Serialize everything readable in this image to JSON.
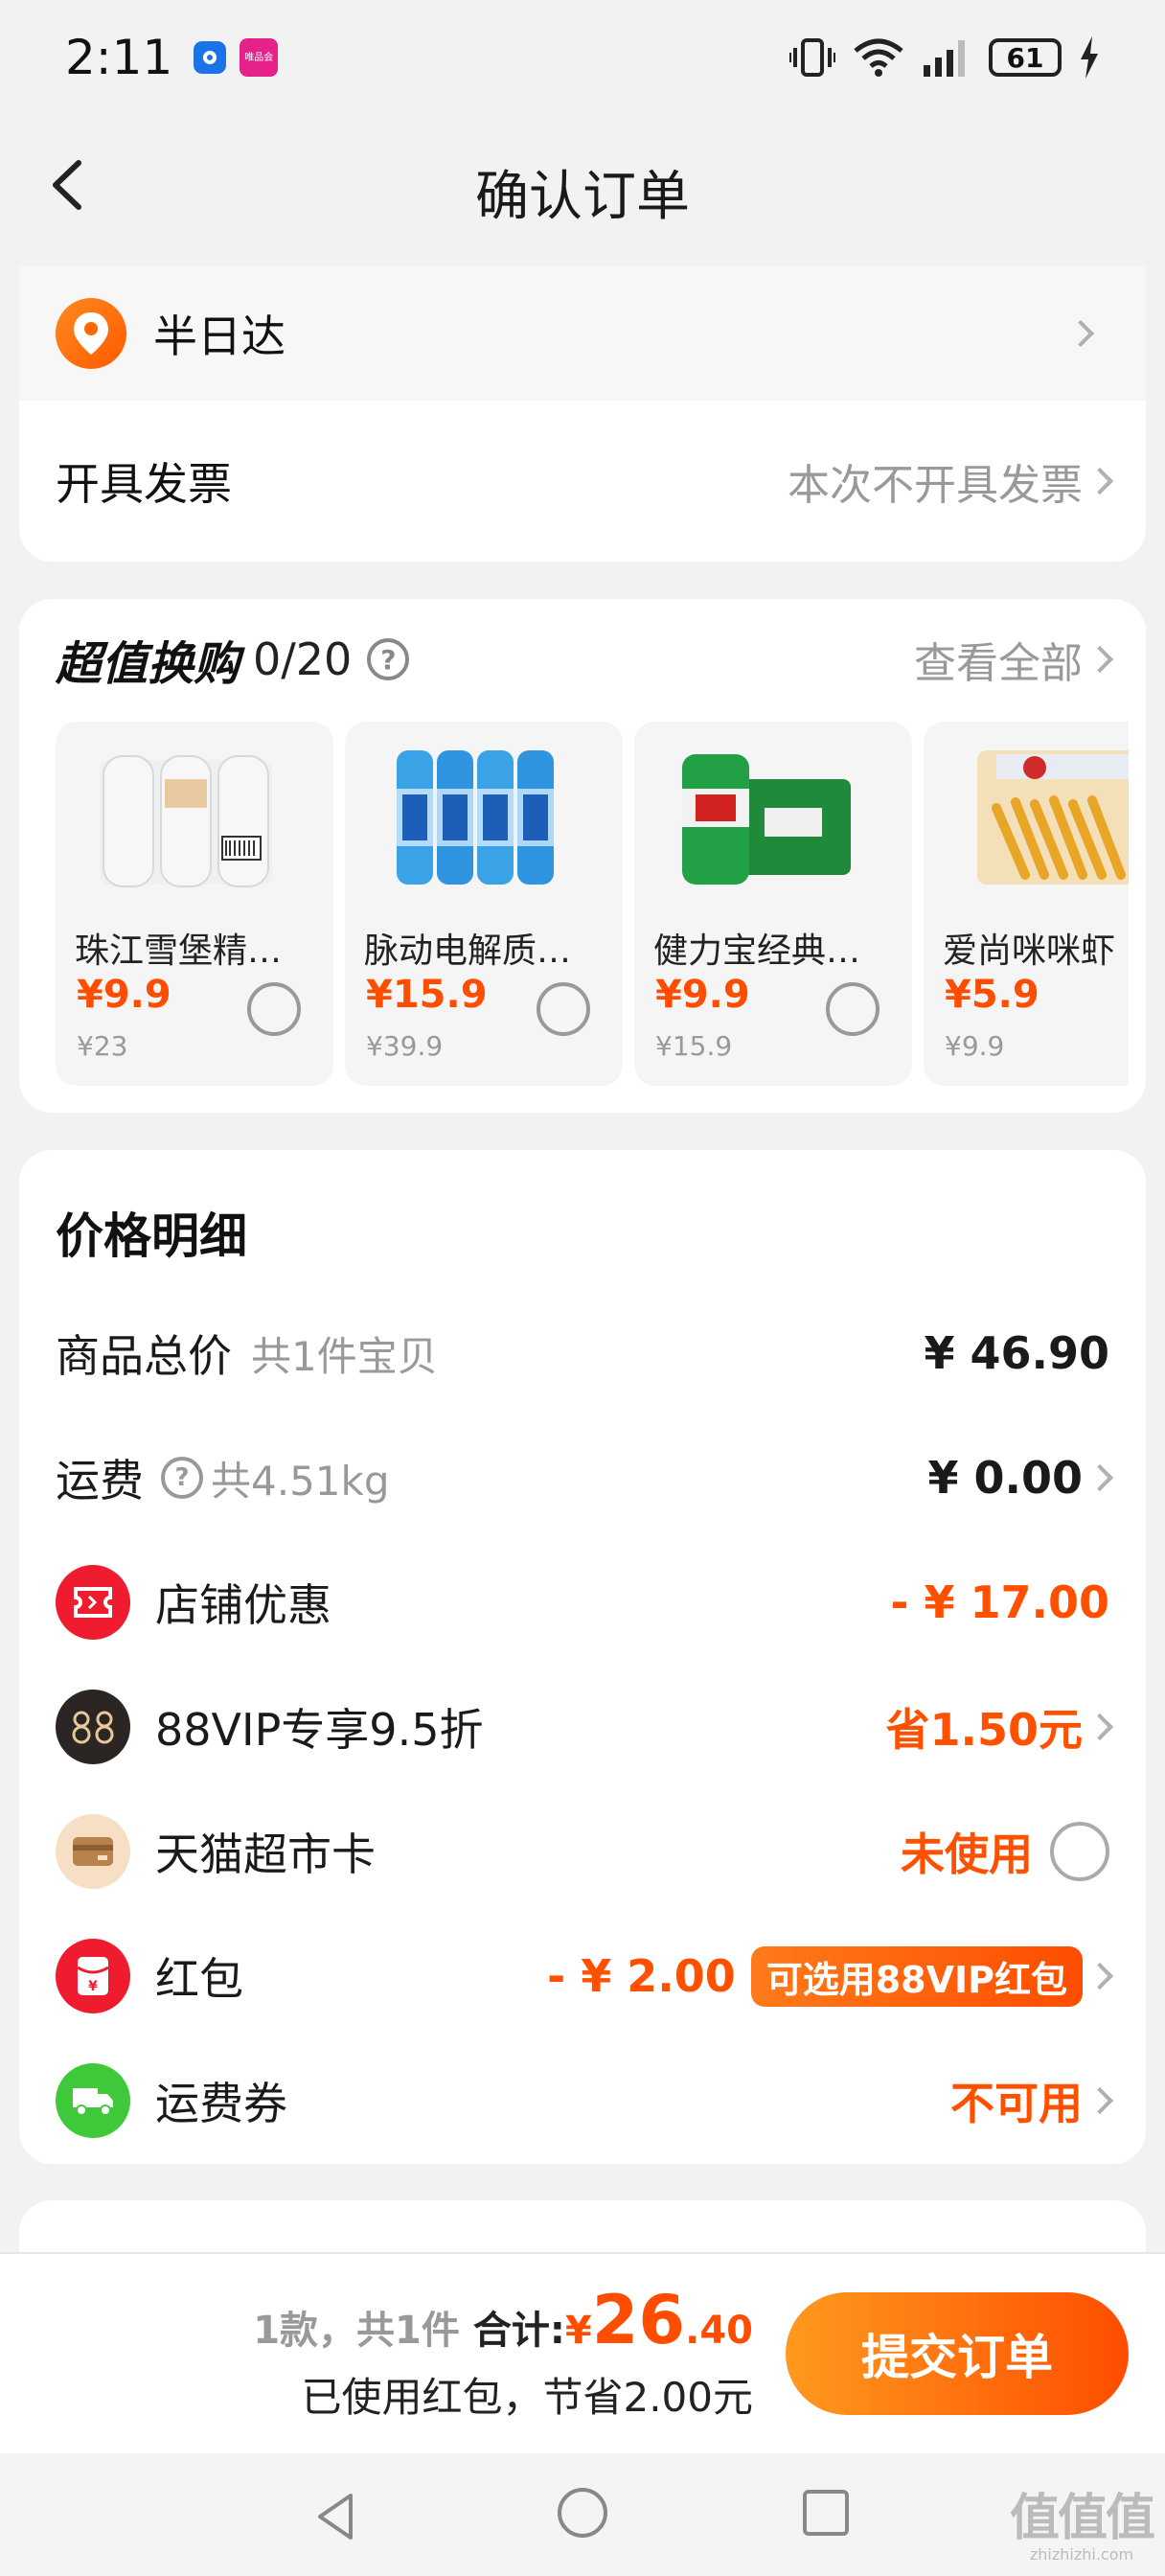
{
  "status_bar": {
    "time": "2:11",
    "app2_label": "唯品会",
    "battery": "61"
  },
  "header": {
    "title": "确认订单"
  },
  "delivery": {
    "label": "半日达"
  },
  "invoice": {
    "label": "开具发票",
    "value": "本次不开具发票"
  },
  "exchange": {
    "title": "超值换购",
    "count": "0/20",
    "view_all": "查看全部",
    "products": [
      {
        "name": "珠江雪堡精…",
        "price": "¥9.9",
        "orig": "¥23"
      },
      {
        "name": "脉动电解质…",
        "price": "¥15.9",
        "orig": "¥39.9"
      },
      {
        "name": "健力宝经典…",
        "price": "¥9.9",
        "orig": "¥15.9"
      },
      {
        "name": "爱尚咪咪虾",
        "price": "¥5.9",
        "orig": "¥9.9"
      }
    ]
  },
  "price_detail": {
    "title": "价格明细",
    "items_total": {
      "label": "商品总价",
      "sub": "共1件宝贝",
      "value": "¥ 46.90"
    },
    "shipping": {
      "label": "运费",
      "sub": "共4.51kg",
      "value": "¥ 0.00"
    },
    "store_discount": {
      "label": "店铺优惠",
      "value": "- ¥ 17.00"
    },
    "vip": {
      "label": "88VIP专享9.5折",
      "value": "省1.50元"
    },
    "market_card": {
      "label": "天猫超市卡",
      "value": "未使用"
    },
    "red_packet": {
      "label": "红包",
      "value": "- ¥ 2.00",
      "tag": "可选用88VIP红包"
    },
    "shipping_coupon": {
      "label": "运费券",
      "value": "不可用"
    }
  },
  "summary": {
    "count": "1款，共1件",
    "total_label": "合计:",
    "yen": "¥",
    "total_int": "26",
    "total_dec": ".40",
    "saved": "已使用红包，节省2.00元"
  },
  "submit_label": "提交订单",
  "watermark": {
    "glyph": "值值值",
    "url": "zhizhizhi.com"
  },
  "colors": {
    "accent": "#ff5000",
    "background": "#f2f2f2",
    "card": "#ffffff"
  }
}
